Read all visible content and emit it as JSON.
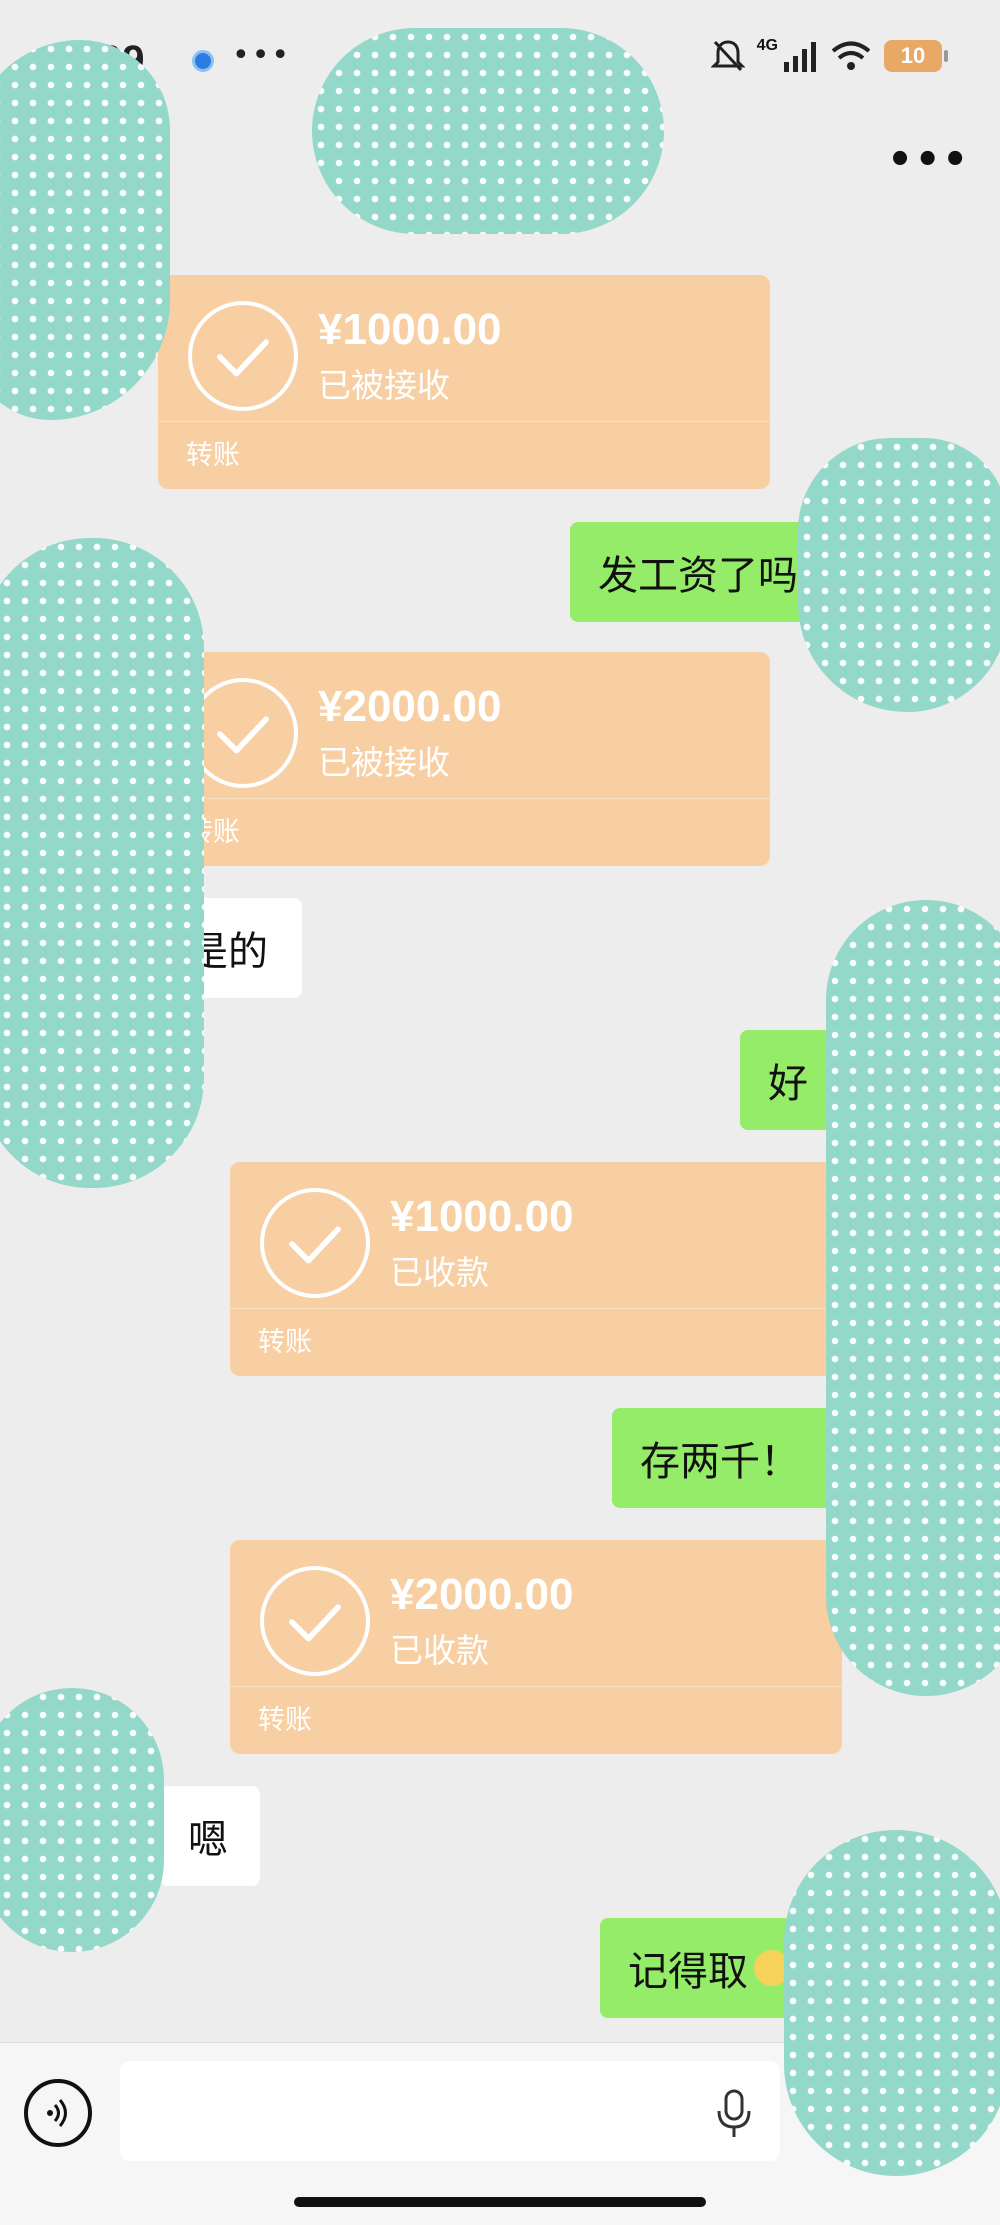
{
  "status_bar": {
    "time": "09",
    "network": "4G",
    "battery": "10"
  },
  "chat": {
    "messages": [
      {
        "type": "transfer",
        "amount": "¥1000.00",
        "state": "已被接收",
        "kind": "转账"
      },
      {
        "type": "text",
        "text": "发工资了吗"
      },
      {
        "type": "transfer",
        "amount": "¥2000.00",
        "state": "已被接收",
        "kind": "转账"
      },
      {
        "type": "text",
        "text": "是的"
      },
      {
        "type": "text",
        "text": "好"
      },
      {
        "type": "transfer",
        "amount": "¥1000.00",
        "state": "已收款",
        "kind": "转账"
      },
      {
        "type": "text",
        "text": "存两千！"
      },
      {
        "type": "transfer",
        "amount": "¥2000.00",
        "state": "已收款",
        "kind": "转账"
      },
      {
        "type": "text",
        "text": "嗯"
      },
      {
        "type": "text",
        "text": "记得取"
      }
    ]
  },
  "colors": {
    "background": "#ededed",
    "transfer_bubble": "#f7cfa3",
    "outgoing_bubble": "#95ec69",
    "incoming_bubble": "#ffffff",
    "sticker_blob": "#93d8c8"
  },
  "icons": {
    "voice": "voice-icon",
    "mic": "mic-icon",
    "emoji": "emoji-icon",
    "check": "check-icon",
    "more": "more-icon"
  }
}
